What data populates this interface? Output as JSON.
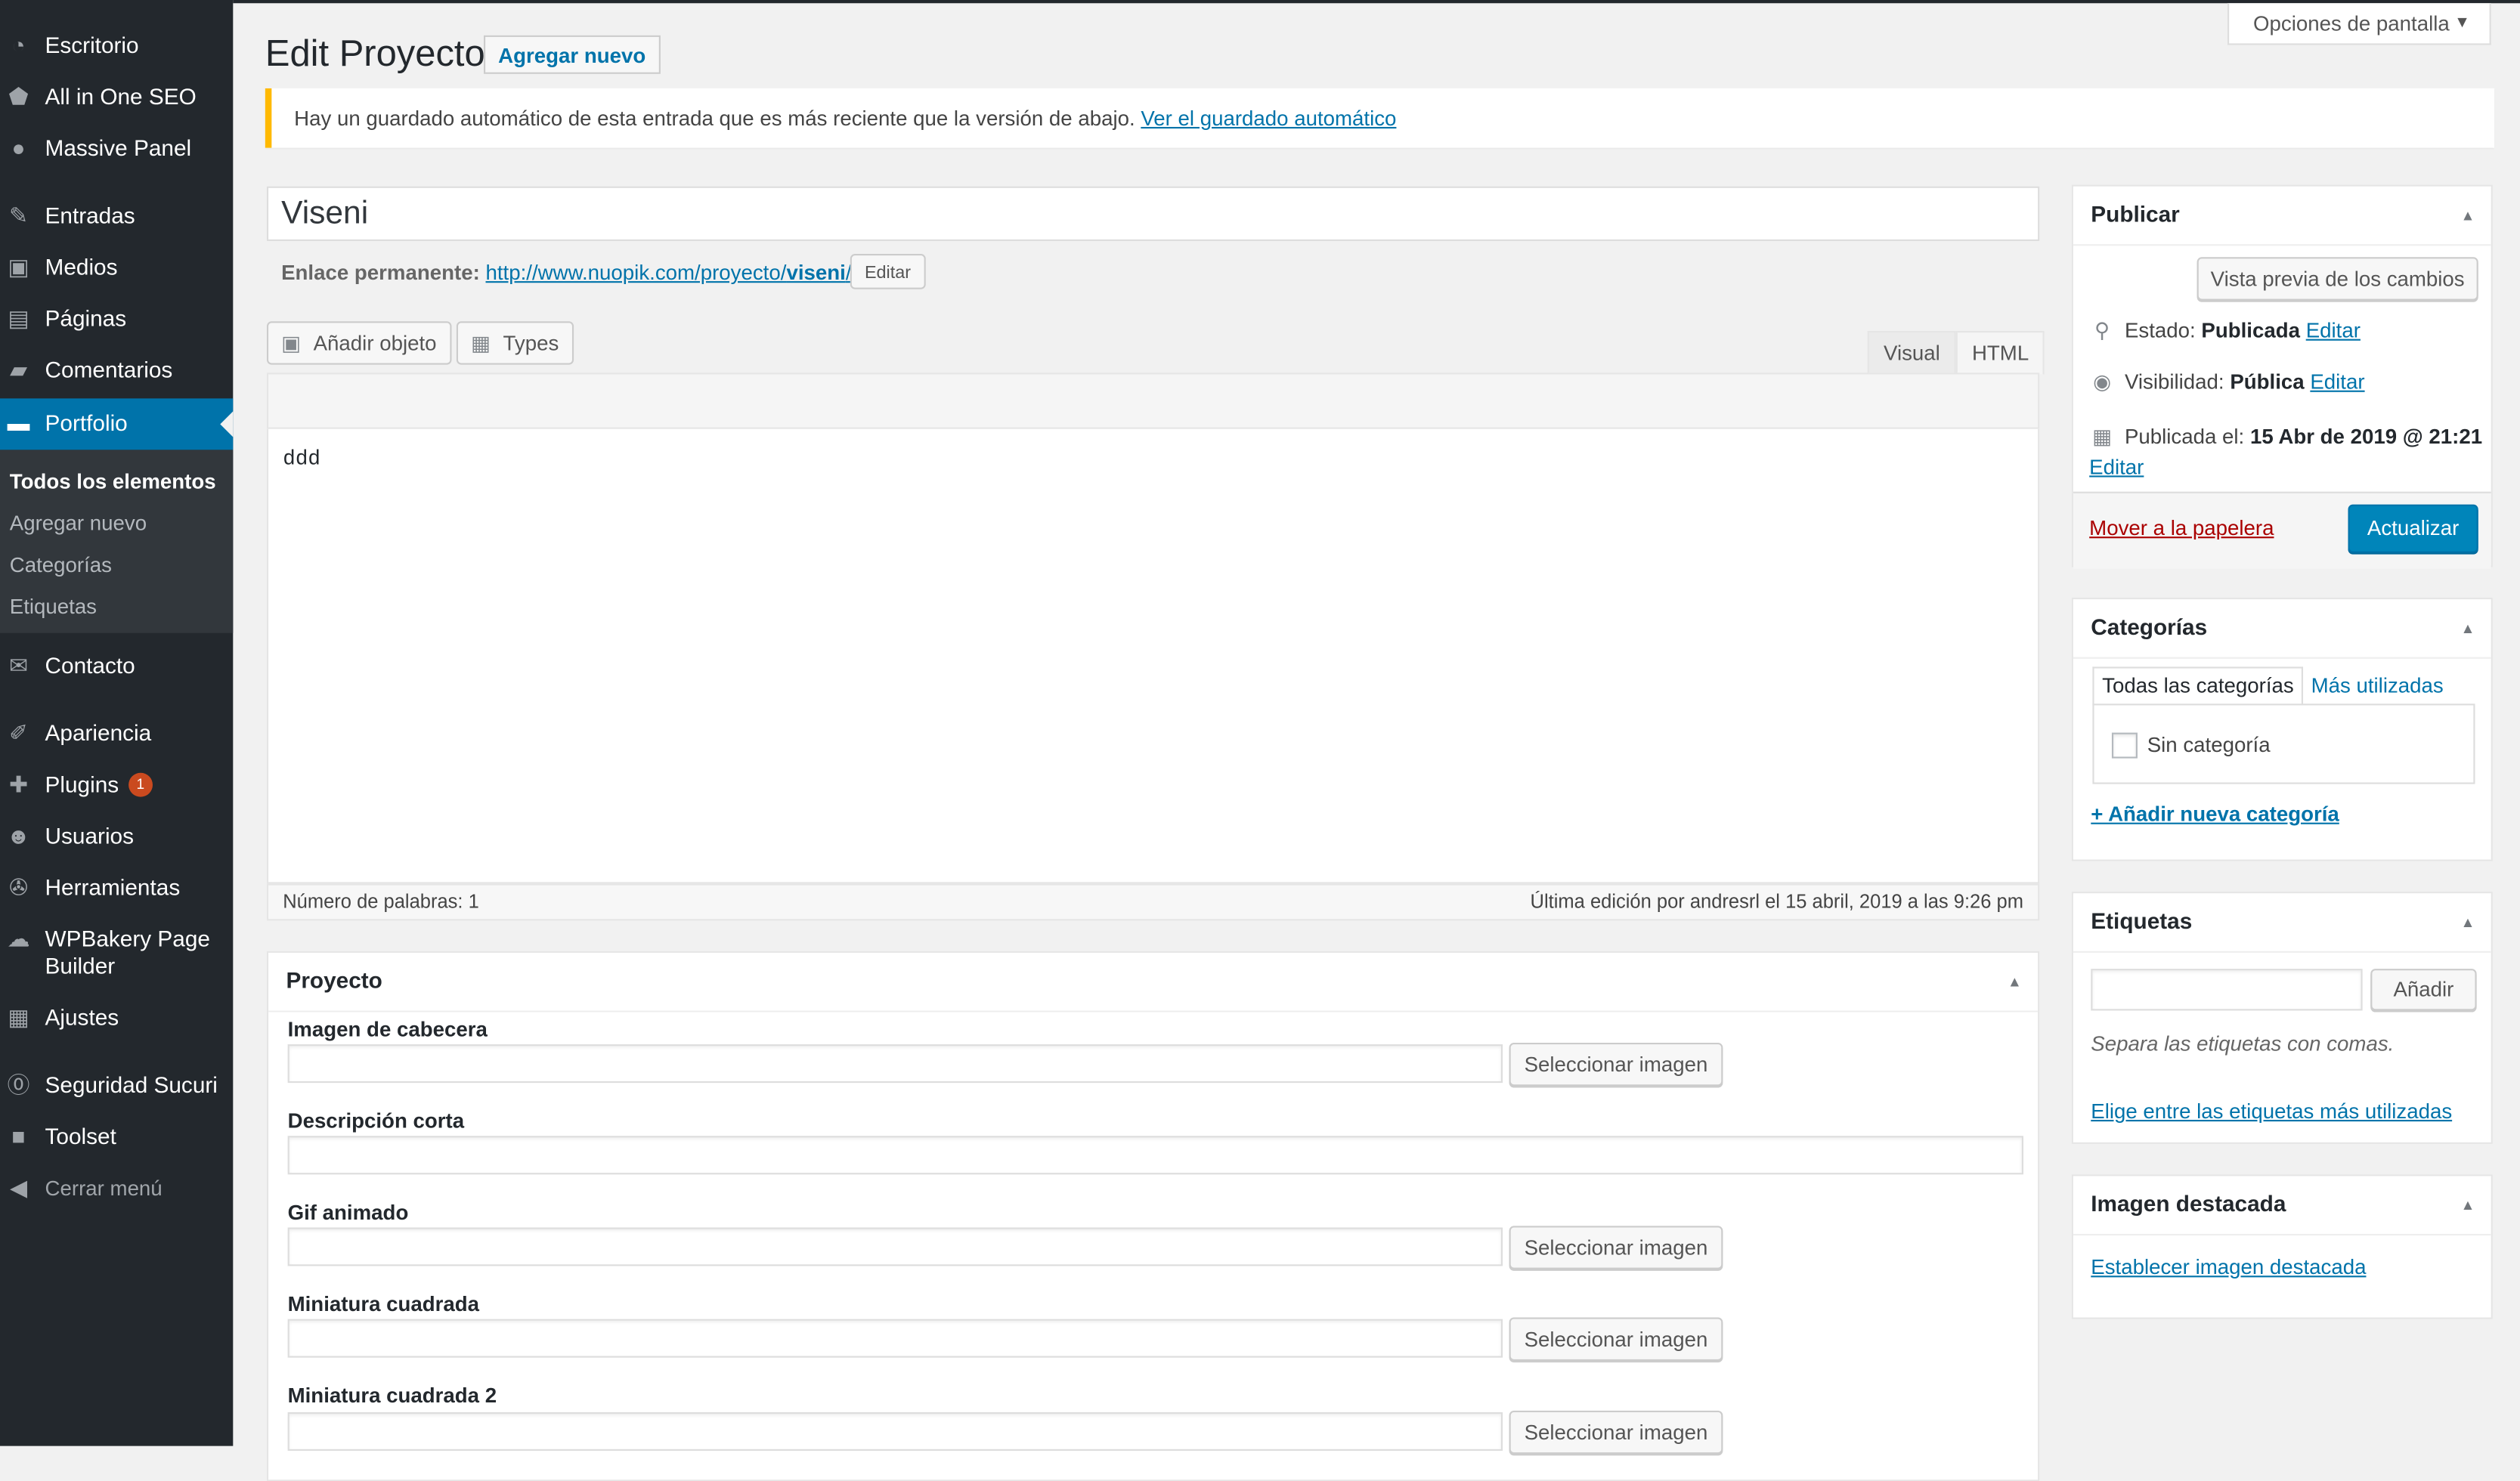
{
  "sidebar": {
    "items": [
      {
        "label": "Escritorio",
        "icon": "dashboard-icon"
      },
      {
        "label": "All in One SEO",
        "icon": "shield-icon"
      },
      {
        "label": "Massive Panel",
        "icon": "lightbulb-icon"
      },
      {
        "label": "Entradas",
        "icon": "pin-icon"
      },
      {
        "label": "Medios",
        "icon": "media-icon"
      },
      {
        "label": "Páginas",
        "icon": "pages-icon"
      },
      {
        "label": "Comentarios",
        "icon": "comment-icon"
      },
      {
        "label": "Portfolio",
        "icon": "folder-icon"
      },
      {
        "label": "Contacto",
        "icon": "email-icon"
      },
      {
        "label": "Apariencia",
        "icon": "brush-icon"
      },
      {
        "label": "Plugins",
        "icon": "plugin-icon",
        "badge": "1"
      },
      {
        "label": "Usuarios",
        "icon": "users-icon"
      },
      {
        "label": "Herramientas",
        "icon": "wrench-icon"
      },
      {
        "label": "WPBakery Page",
        "label2": "Builder",
        "icon": "cloud-icon"
      },
      {
        "label": "Ajustes",
        "icon": "settings-icon"
      },
      {
        "label": "Seguridad Sucuri",
        "icon": "sucuri-icon"
      },
      {
        "label": "Toolset",
        "icon": "toolset-icon"
      }
    ],
    "submenu": [
      "Todos los elementos",
      "Agregar nuevo",
      "Categorías",
      "Etiquetas"
    ],
    "collapse": "Cerrar menú"
  },
  "screen_options": "Opciones de pantalla",
  "header": {
    "title": "Edit Proyecto",
    "add_new": "Agregar nuevo"
  },
  "notice": {
    "text": "Hay un guardado automático de esta entrada que es más reciente que la versión de abajo.",
    "link": "Ver el guardado automático"
  },
  "post": {
    "title": "Viseni",
    "permalink_label": "Enlace permanente:",
    "permalink_base": "http://www.nuopik.com/proyecto/",
    "permalink_slug": "viseni",
    "permalink_end": "/",
    "permalink_edit": "Editar"
  },
  "editor": {
    "add_media": "Añadir objeto",
    "types": "Types",
    "tab_visual": "Visual",
    "tab_html": "HTML",
    "content": "ddd",
    "word_count": "Número de palabras: 1",
    "last_edit": "Última edición por andresrl el 15 abril, 2019 a las 9:26 pm"
  },
  "proyecto": {
    "title": "Proyecto",
    "select_image": "Seleccionar imagen",
    "fields": [
      "Imagen de cabecera",
      "Descripción corta",
      "Gif animado",
      "Miniatura cuadrada",
      "Miniatura cuadrada 2"
    ]
  },
  "publish": {
    "title": "Publicar",
    "preview": "Vista previa de los cambios",
    "status_label": "Estado:",
    "status_value": "Publicada",
    "visibility_label": "Visibilidad:",
    "visibility_value": "Pública",
    "published_label": "Publicada el:",
    "published_value": "15 Abr de 2019 @ 21:21",
    "edit": "Editar",
    "trash": "Mover a la papelera",
    "update": "Actualizar"
  },
  "categories": {
    "title": "Categorías",
    "tab_all": "Todas las categorías",
    "tab_popular": "Más utilizadas",
    "item": "Sin categoría",
    "add_new": "+ Añadir nueva categoría"
  },
  "tags": {
    "title": "Etiquetas",
    "add": "Añadir",
    "hint": "Separa las etiquetas con comas.",
    "choose": "Elige entre las etiquetas más utilizadas"
  },
  "featured": {
    "title": "Imagen destacada",
    "set": "Establecer imagen destacada"
  }
}
